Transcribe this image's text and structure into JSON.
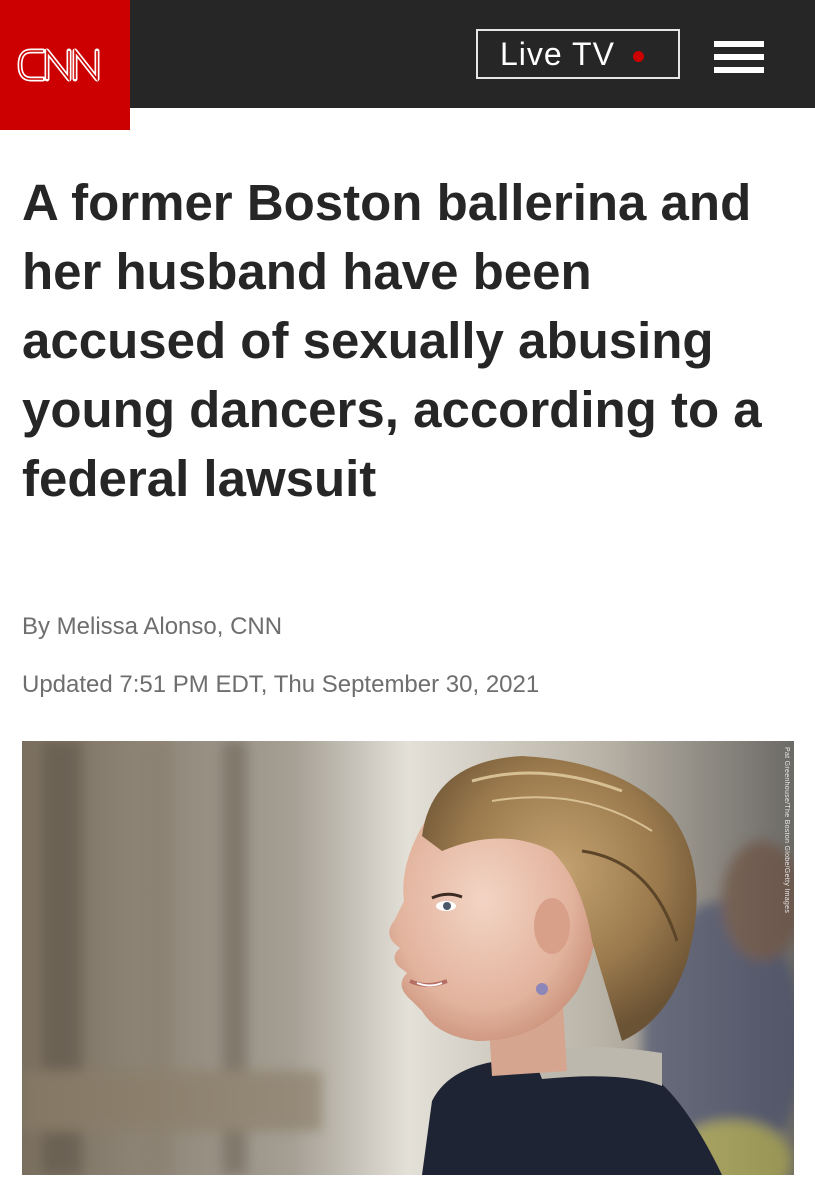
{
  "header": {
    "logo_text": "CNN",
    "live_tv_label": "Live TV",
    "icons": {
      "live_indicator": "red-dot-icon",
      "menu": "hamburger-menu-icon"
    }
  },
  "article": {
    "headline": "A former Boston ballerina and her husband have been accused of sexually abusing young dancers, according to a federal lawsuit",
    "byline": "By Melissa Alonso, CNN",
    "updated": "Updated 7:51 PM EDT, Thu September 30, 2021",
    "image_credit": "Pat Greenhouse/The Boston Globe/Getty Images"
  },
  "colors": {
    "brand_red": "#cc0000",
    "header_bg": "#262626",
    "headline_text": "#262626",
    "meta_text": "#6e6e6e"
  }
}
